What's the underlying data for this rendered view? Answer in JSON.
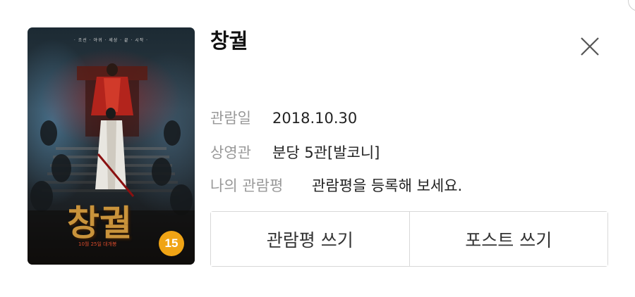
{
  "movie": {
    "title": "창궐",
    "poster": {
      "tagline": "· 조선 · 야귀 · 세상 · 끝 · 시작 ·",
      "title_art": "창궐",
      "tagline_small": "이 밤 세상 출몰하리라",
      "release_text": "10월 25일 대개봉",
      "rating_badge": "15",
      "accent_colors": [
        "#c9933b",
        "#b22222",
        "#f0a415"
      ]
    }
  },
  "info": {
    "date_label": "관람일",
    "date_value": "2018.10.30",
    "theater_label": "상영관",
    "theater_value": "분당 5관[발코니]",
    "review_label": "나의 관람평",
    "review_value": "관람평을 등록해 보세요."
  },
  "actions": {
    "write_review": "관람평 쓰기",
    "write_post": "포스트 쓰기"
  },
  "close_icon": "close-icon"
}
